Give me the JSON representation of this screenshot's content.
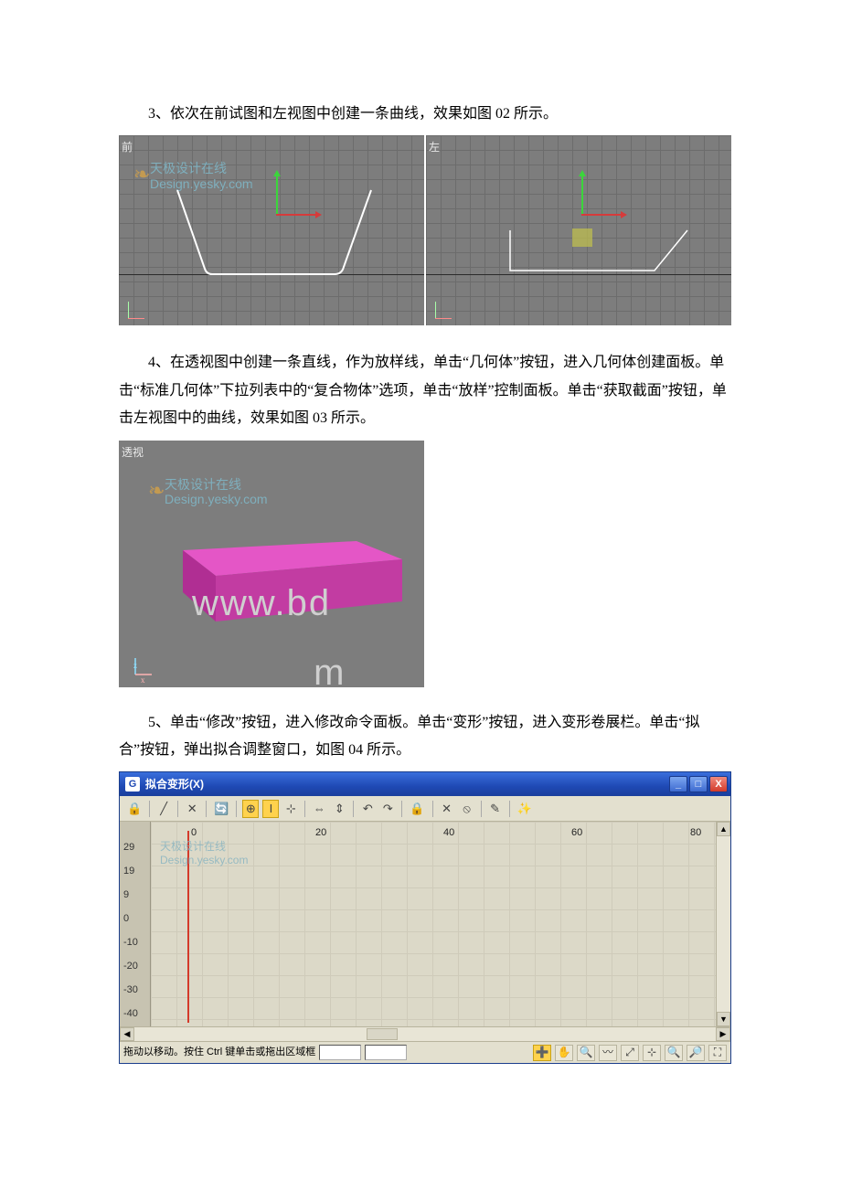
{
  "para3": "3、依次在前试图和左视图中创建一条曲线，效果如图 02 所示。",
  "para4": "4、在透视图中创建一条直线，作为放样线，单击“几何体”按钮，进入几何体创建面板。单击“标准几何体”下拉列表中的“复合物体”选项，单击“放样”控制面板。单击“获取截面”按钮，单击左视图中的曲线，效果如图 03 所示。",
  "para5": "5、单击“修改”按钮，进入修改命令面板。单击“变形”按钮，进入变形卷展栏。单击“拟合”按钮，弹出拟合调整窗口，如图 04 所示。",
  "fig1": {
    "left_label": "前",
    "right_label": "左",
    "watermark_line1": "天极设计在线",
    "watermark_line2": "Design.yesky.com",
    "axis_x": "x",
    "axis_y": "y"
  },
  "fig2": {
    "label": "透视",
    "watermark_line1": "天极设计在线",
    "watermark_line2": "Design.yesky.com",
    "big_wm_left": "www.bd",
    "big_wm_right": "m",
    "axis_z": "z",
    "axis_x": "x"
  },
  "dialog": {
    "title": "拟合变形(X)",
    "win_min": "_",
    "win_max": "□",
    "win_close": "X",
    "toolbar_icons": [
      "🔒",
      "╱",
      "✕",
      "🔄",
      "⊕",
      "I",
      "⊹",
      "⇔",
      "⇕",
      "↶",
      "↷",
      "🔒",
      "✕",
      "⦸",
      "✎",
      "✨"
    ],
    "x_ticks": [
      "0",
      "20",
      "40",
      "60",
      "80"
    ],
    "y_ticks": [
      "29",
      "19",
      "9",
      "0",
      "-10",
      "-20",
      "-30",
      "-40"
    ],
    "watermark_line1": "天极设计在线",
    "watermark_line2": "Design.yesky.com",
    "status_msg": "拖动以移动。按住 Ctrl 键单击或拖出区域框",
    "status_icons": [
      "➕",
      "✋",
      "🔍",
      "〰",
      "⤢",
      "⊹",
      "🔍",
      "🔎",
      "⛶"
    ]
  }
}
